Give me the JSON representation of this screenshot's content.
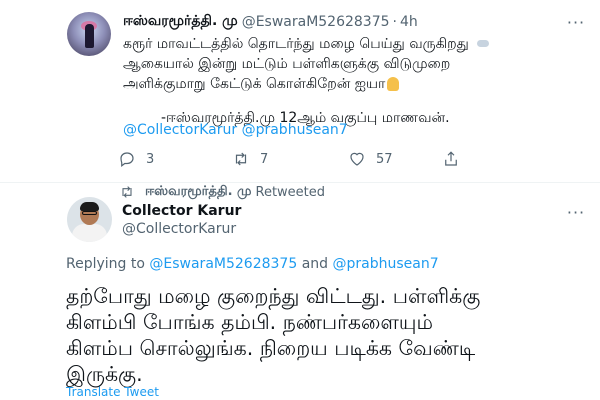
{
  "original_tweet": {
    "author_name": "ஈஸ்வரமூர்த்தி. மு",
    "author_handle": "@EswaraM52628375",
    "separator": "·",
    "time": "4h",
    "text_lines": [
      "கரூர் மாவட்டத்தில் தொடர்ந்து மழை பெய்து வருகிறது",
      "ஆகையால் இன்று மட்டும் பள்ளிகளுக்கு விடுமுறை",
      "அளிக்குமாறு கேட்டுக் கொள்கிறேன் ஐயா"
    ],
    "signature": "-ஈஸ்வரமூர்த்தி.மு 12ஆம் வகுப்பு மாணவன்.",
    "mentions": "@CollectorKarur @prabhusean7",
    "reply_count": "3",
    "retweet_count": "7",
    "like_count": "57",
    "icons": {
      "reply": "reply-icon",
      "retweet": "retweet-icon",
      "like": "heart-icon",
      "share": "share-icon",
      "more": "more-icon",
      "emoji_1": "cloud-rain-emoji",
      "emoji_2": "folded-hands-emoji"
    }
  },
  "retweet_banner": {
    "name": "ஈஸ்வரமூர்த்தி. மு",
    "label": "Retweeted"
  },
  "reply_tweet": {
    "author_name": "Collector Karur",
    "author_handle": "@CollectorKarur",
    "replying_prefix": "Replying to",
    "replying_user_1": "@EswaraM52628375",
    "replying_and": "and",
    "replying_user_2": "@prabhusean7",
    "text_lines": [
      "தற்போது மழை குறைந்து விட்டது. பள்ளிக்கு",
      "கிளம்பி போங்க தம்பி. நண்பர்களையும்",
      "கிளம்ப சொல்லுங்க. நிறைய படிக்க வேண்டி",
      "இருக்கு."
    ],
    "translate_label": "Translate Tweet"
  },
  "colors": {
    "link": "#1d9bf0",
    "secondary_text": "#536471",
    "primary_text": "#0f1419",
    "divider": "#eff3f4"
  }
}
